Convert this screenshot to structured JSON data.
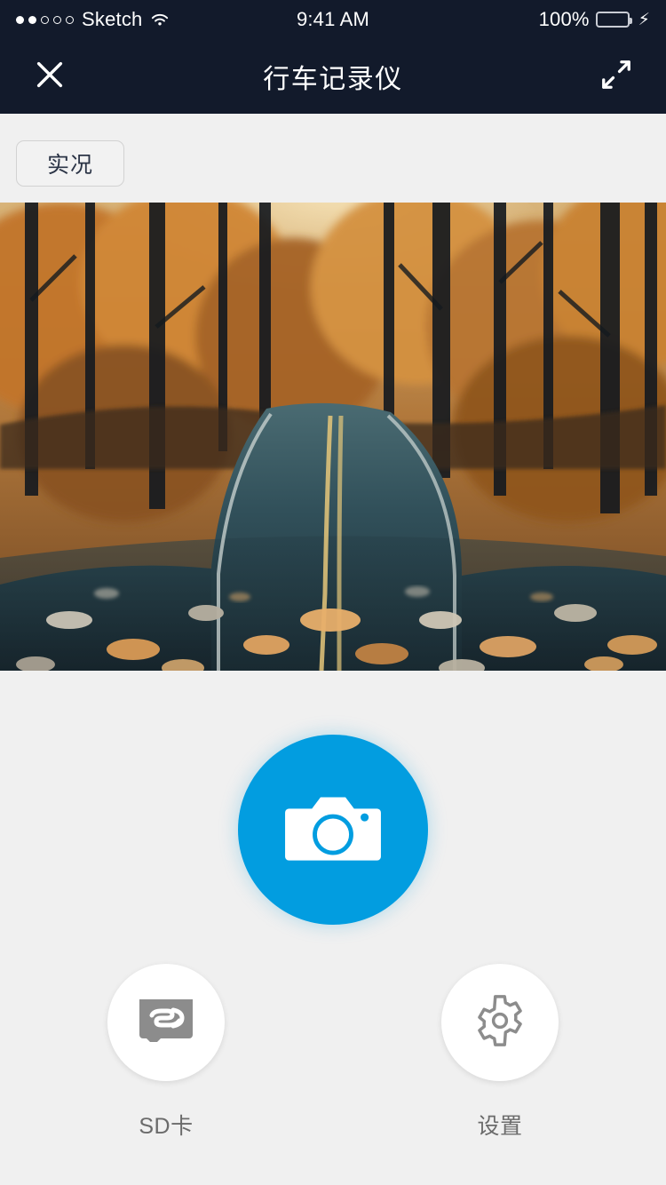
{
  "status_bar": {
    "signal_dots": [
      true,
      true,
      false,
      false,
      false
    ],
    "carrier": "Sketch",
    "wifi_icon": "wifi-icon",
    "time": "9:41 AM",
    "battery_percent": "100%",
    "battery_level": 100,
    "charging": true,
    "charging_icon": "⚡",
    "battery_color": "#4cd763",
    "background_color": "#121a2b"
  },
  "navbar": {
    "close_icon": "close-icon",
    "title": "行车记录仪",
    "expand_icon": "expand-icon",
    "background_color": "#121a2b",
    "text_color": "#ffffff"
  },
  "toolbar": {
    "live_label": "实况"
  },
  "preview": {
    "scene_description": "autumn-forest-road",
    "alt": "行车记录仪实况画面"
  },
  "controls": {
    "shutter": {
      "icon": "camera-icon",
      "color": "#029de0"
    },
    "buttons": [
      {
        "icon": "sd-card-icon",
        "label": "SD卡"
      },
      {
        "icon": "gear-icon",
        "label": "设置"
      }
    ]
  },
  "theme": {
    "page_background": "#f0f0f0",
    "accent": "#029de0",
    "icon_gray": "#8c8c8c",
    "label_gray": "#6b6b6b"
  }
}
